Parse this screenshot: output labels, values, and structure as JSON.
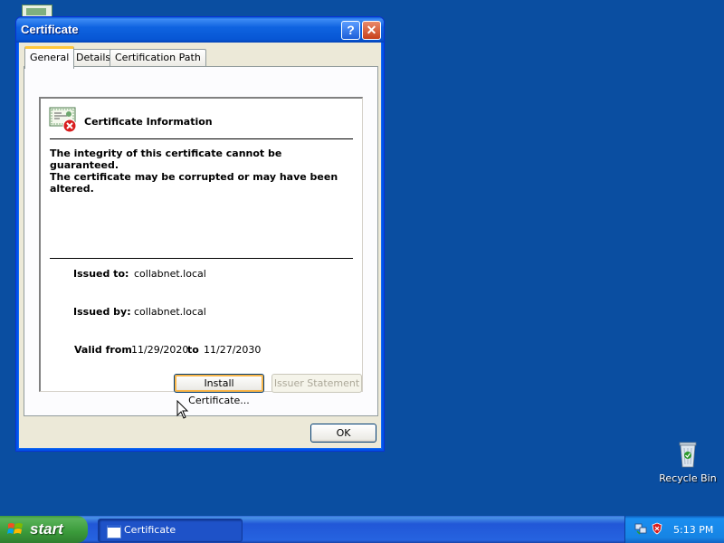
{
  "window": {
    "title": "Certificate",
    "help_label": "?",
    "close_label": "✕"
  },
  "tabs": [
    {
      "label": "General",
      "active": true
    },
    {
      "label": "Details",
      "active": false
    },
    {
      "label": "Certification Path",
      "active": false
    }
  ],
  "info": {
    "heading": "Certificate Information",
    "warning_line1": "The integrity of this certificate cannot be guaranteed.",
    "warning_line2": "The certificate may be corrupted or may have been",
    "warning_line3": "altered.",
    "issued_to_label": "Issued to:",
    "issued_to_value": "collabnet.local",
    "issued_by_label": "Issued by:",
    "issued_by_value": "collabnet.local",
    "valid_from_label": "Valid from",
    "valid_from_value": "11/29/2020",
    "valid_to_label": "to",
    "valid_to_value": "11/27/2030"
  },
  "buttons": {
    "install": "Install Certificate...",
    "issuer_statement": "Issuer Statement",
    "ok": "OK"
  },
  "desktop": {
    "recycle_bin": "Recycle Bin"
  },
  "taskbar": {
    "start_label": "start",
    "task_title": "Certificate",
    "clock": "5:13 PM"
  },
  "colors": {
    "desktop_bg": "#0a4ea1",
    "title_bar": "#0756d4",
    "dialog_face": "#ece9d8",
    "start_green": "#3a9a3a",
    "tab_accent": "#ffc73c"
  },
  "icons": {
    "certificate": "certificate-error-icon",
    "recycle_bin": "recycle-bin-icon",
    "windows_flag": "windows-flag-icon",
    "tray_network": "network-icon",
    "tray_security": "security-alert-icon"
  }
}
